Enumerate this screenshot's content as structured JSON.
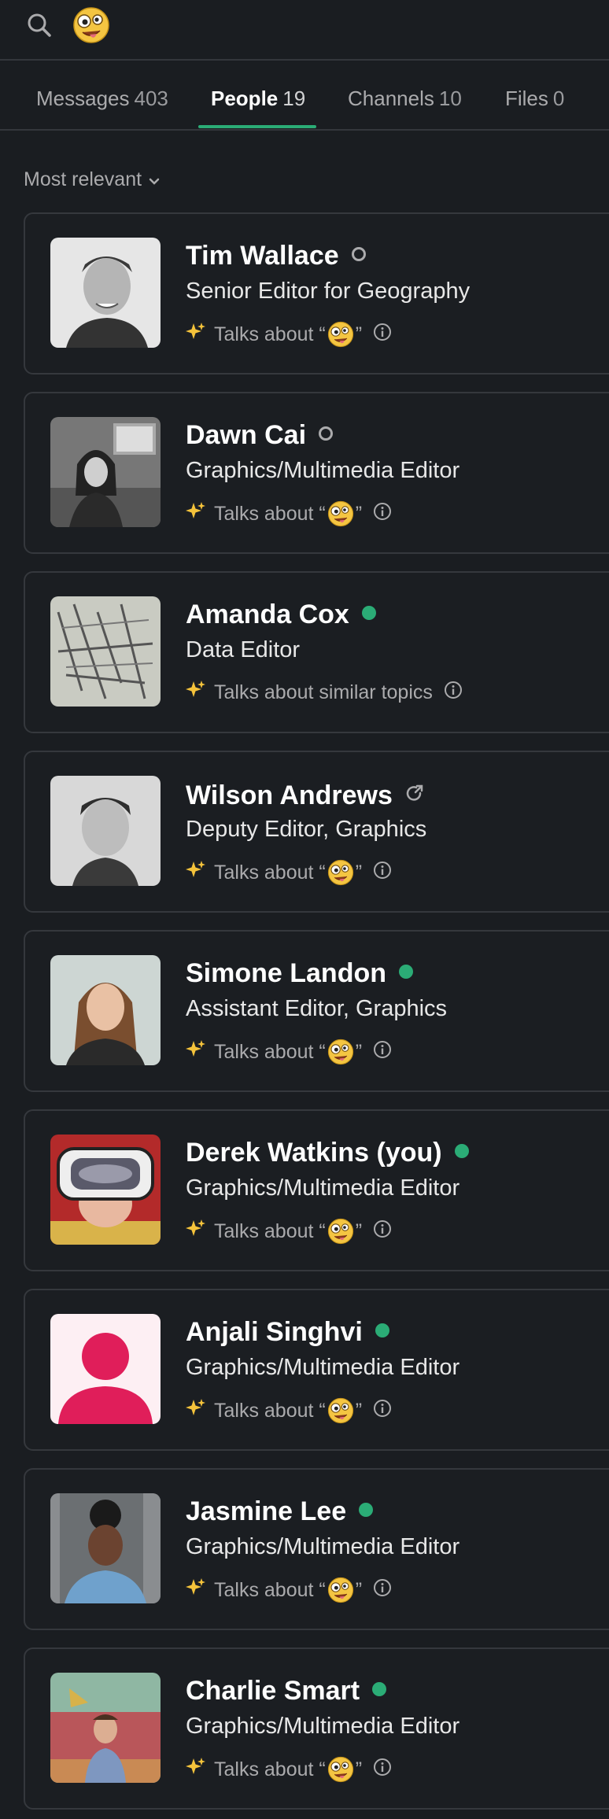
{
  "header": {
    "search_icon": "search-icon",
    "emoji_icon": "crazy-face-icon"
  },
  "tabs": [
    {
      "label": "Messages",
      "count": "403",
      "active": false
    },
    {
      "label": "People",
      "count": "19",
      "active": true
    },
    {
      "label": "Channels",
      "count": "10",
      "active": false
    },
    {
      "label": "Files",
      "count": "0",
      "active": false
    }
  ],
  "sort": {
    "label": "Most relevant"
  },
  "colors": {
    "accent": "#2bac76",
    "background": "#1a1d21",
    "card_border": "#35383d"
  },
  "people": [
    {
      "name": "Tim Wallace",
      "title": "Senior Editor for Geography",
      "status": "away",
      "talks_prefix": "Talks about “",
      "talks_suffix": "”",
      "talks_emoji": true
    },
    {
      "name": "Dawn Cai",
      "title": "Graphics/Multimedia Editor",
      "status": "away",
      "talks_prefix": "Talks about “",
      "talks_suffix": "”",
      "talks_emoji": true
    },
    {
      "name": "Amanda Cox",
      "title": "Data Editor",
      "status": "active",
      "talks_prefix": "Talks about similar topics",
      "talks_suffix": "",
      "talks_emoji": false
    },
    {
      "name": "Wilson Andrews",
      "title": "Deputy Editor, Graphics",
      "status": "external",
      "talks_prefix": "Talks about “",
      "talks_suffix": "”",
      "talks_emoji": true
    },
    {
      "name": "Simone Landon",
      "title": "Assistant Editor, Graphics",
      "status": "active",
      "talks_prefix": "Talks about “",
      "talks_suffix": "”",
      "talks_emoji": true
    },
    {
      "name": "Derek Watkins (you)",
      "title": "Graphics/Multimedia Editor",
      "status": "active",
      "talks_prefix": "Talks about “",
      "talks_suffix": "”",
      "talks_emoji": true
    },
    {
      "name": "Anjali Singhvi",
      "title": "Graphics/Multimedia Editor",
      "status": "active",
      "talks_prefix": "Talks about “",
      "talks_suffix": "”",
      "talks_emoji": true
    },
    {
      "name": "Jasmine Lee",
      "title": "Graphics/Multimedia Editor",
      "status": "active",
      "talks_prefix": "Talks about “",
      "talks_suffix": "”",
      "talks_emoji": true
    },
    {
      "name": "Charlie Smart",
      "title": "Graphics/Multimedia Editor",
      "status": "active",
      "talks_prefix": "Talks about “",
      "talks_suffix": "”",
      "talks_emoji": true
    }
  ]
}
